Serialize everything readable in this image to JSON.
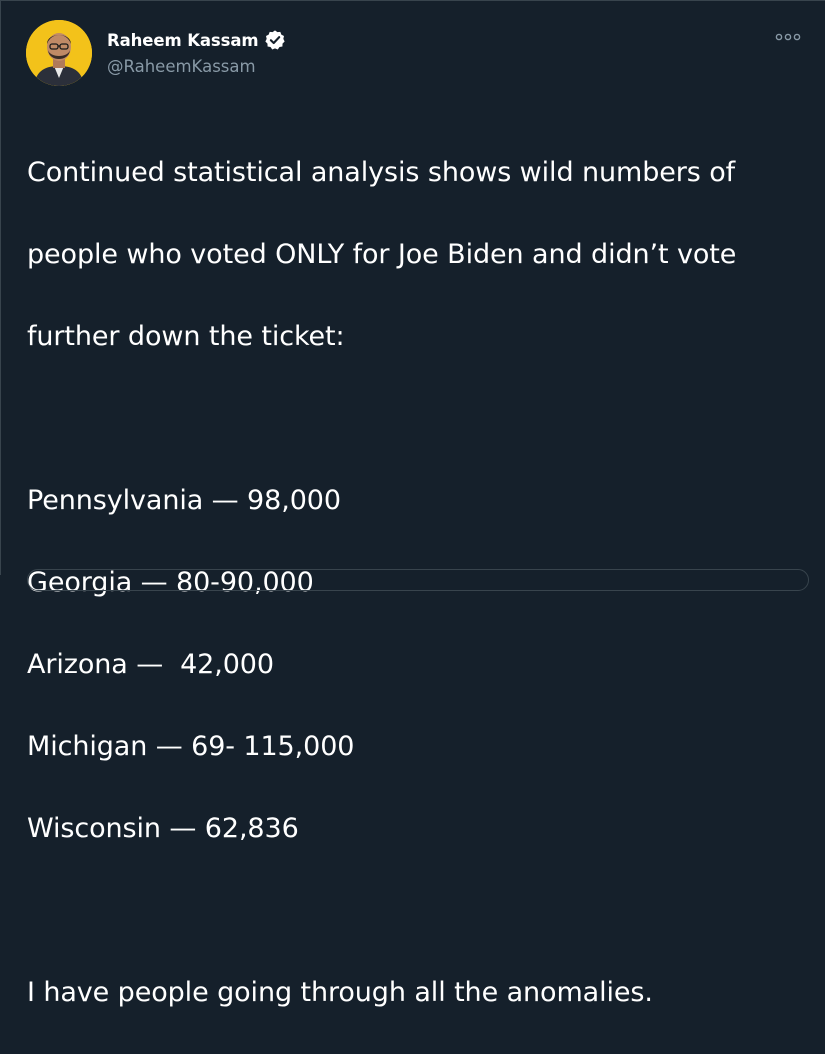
{
  "author": {
    "display_name": "Raheem Kassam",
    "handle": "@RaheemKassam",
    "verified": true,
    "avatar_icon": "profile-photo"
  },
  "tweet": {
    "intro_lines": [
      "Continued statistical analysis shows wild numbers of",
      "people who voted ONLY for Joe Biden and didn’t vote",
      "further down the ticket:"
    ],
    "state_lines": [
      "Pennsylvania — 98,000",
      "Georgia — 80-90,000",
      "Arizona —  42,000",
      "Michigan — 69- 115,000",
      "Wisconsin — 62,836"
    ],
    "closing_line": "I have people going through all the anomalies."
  },
  "icons": {
    "more": "more-options-icon",
    "verified": "verified-badge-icon"
  },
  "colors": {
    "background": "#15202b",
    "text": "#ffffff",
    "secondary_text": "#8899a6",
    "verified_badge": "#ffffff",
    "avatar_bg": "#f3c21a"
  }
}
